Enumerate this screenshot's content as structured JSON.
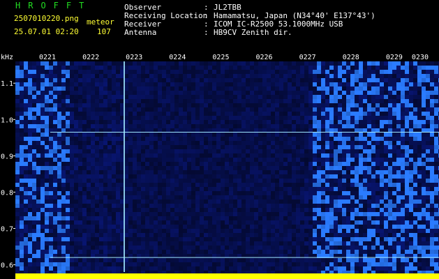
{
  "header": {
    "brand": "HROFFT",
    "filename": "2507010220.png",
    "datetime": "25.07.01 02:20",
    "mode": "meteor",
    "count": "107",
    "fields": [
      {
        "label": "Observer",
        "value": "JL2TBB"
      },
      {
        "label": "Receiving Location",
        "value": "Hamamatsu, Japan (N34°40' E137°43')"
      },
      {
        "label": "Receiver",
        "value": "ICOM IC-R2500 53.1000MHz USB"
      },
      {
        "label": "Antenna",
        "value": "HB9CV Zenith dir."
      }
    ],
    "separator": ":"
  },
  "spectrogram": {
    "y_unit": "kHz",
    "y_ticks": [
      "1.1",
      "1.0",
      "0.9",
      "0.8",
      "0.7",
      "0.6"
    ],
    "y_tick_values": [
      1.1,
      1.0,
      0.9,
      0.8,
      0.7,
      0.6
    ],
    "y_range": [
      0.58,
      1.16
    ],
    "x_ticks": [
      "0221",
      "0222",
      "0223",
      "0224",
      "0225",
      "0226",
      "0227",
      "0228",
      "0229",
      "0230"
    ],
    "carrier_freqs_khz": [
      0.965,
      0.62
    ],
    "colors": {
      "background": "#000000",
      "noise_base": "#0a1a8c",
      "noise_bright": "#2a7bff",
      "tick_text": "#ffffff",
      "carrier": "#9fe6ff",
      "bottom_bar": "#ffff00"
    }
  }
}
